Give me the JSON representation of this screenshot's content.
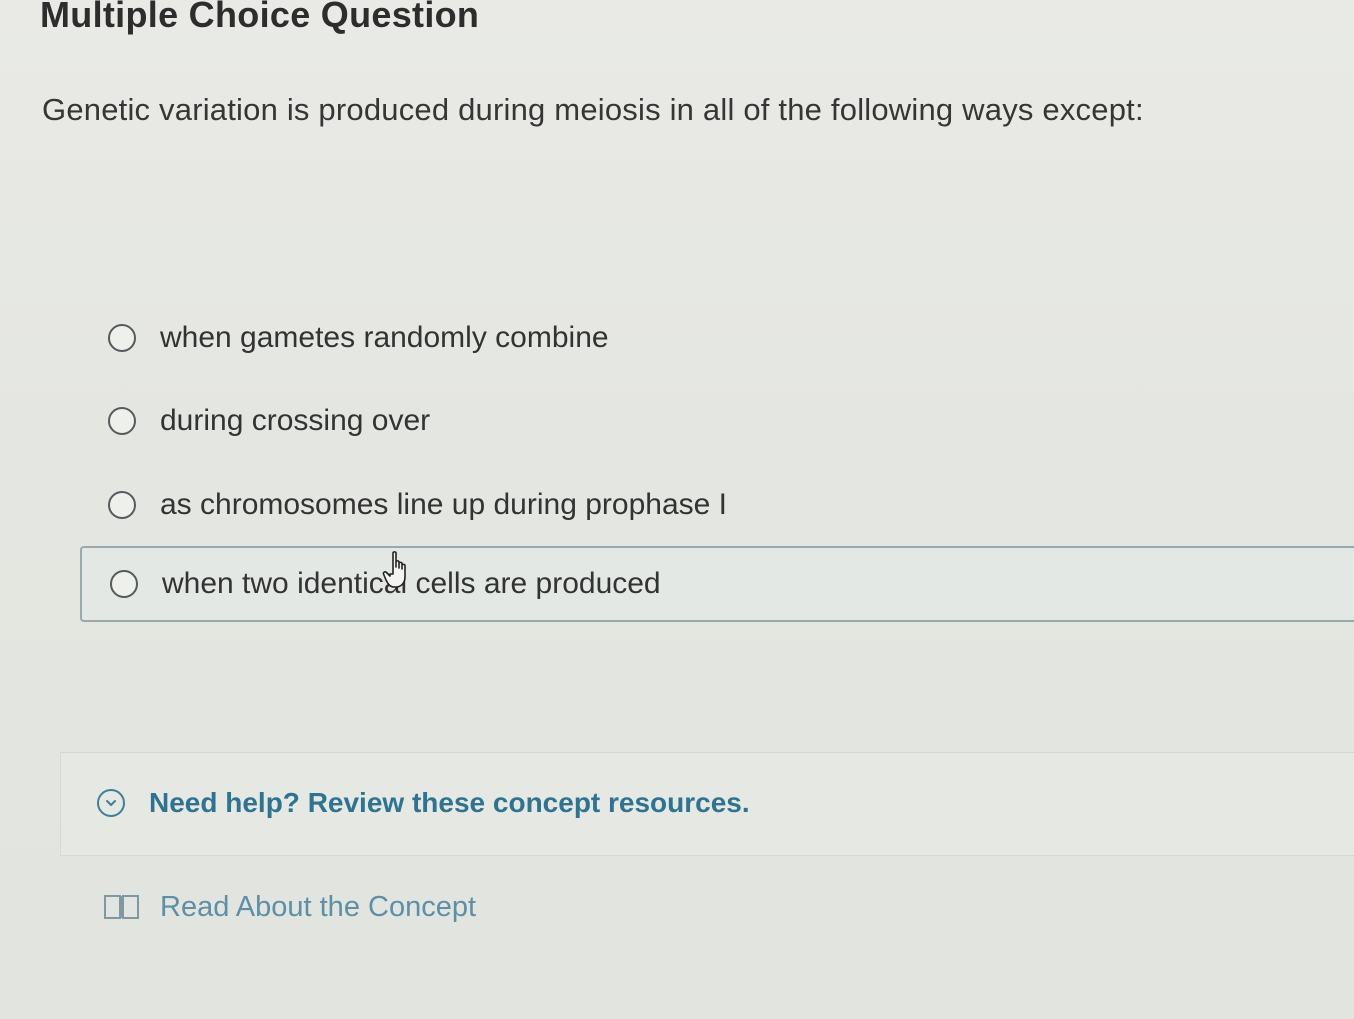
{
  "heading": "Multiple Choice Question",
  "question": "Genetic variation is produced during meiosis in all of the following ways except:",
  "options": [
    {
      "label": "when gametes randomly combine"
    },
    {
      "label": "during crossing over"
    },
    {
      "label": "as chromosomes line up during prophase I"
    },
    {
      "label": "when two identical cells are produced"
    }
  ],
  "help": {
    "toggle_label": "Need help? Review these concept resources.",
    "read_label": "Read About the Concept"
  },
  "colors": {
    "accent": "#2f7390",
    "link": "#5d8fa6",
    "hover_border": "#9aa8ad"
  },
  "icons": {
    "help_toggle": "chevron-down-icon",
    "read": "book-icon",
    "cursor": "hand-pointer-icon"
  }
}
